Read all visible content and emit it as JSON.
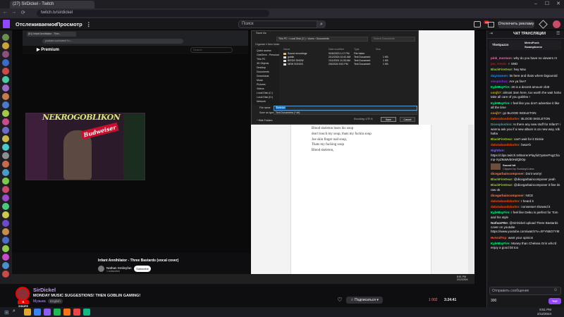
{
  "browser": {
    "tab_title": "(27) SirDickel - Twitch",
    "url": "twitch.tv/sirdickel",
    "window_controls": [
      "–",
      "☐",
      "✕"
    ],
    "nav_icons": [
      "←",
      "→",
      "⟳"
    ]
  },
  "twitch_nav": {
    "following": "Отслеживаемое",
    "browse": "Просмотр",
    "more": "⋮",
    "search_placeholder": "Поиск",
    "search_icon": "⌕",
    "notif_count": "42",
    "ads_button": "Отключить рекламу",
    "icons": [
      "crown-icon",
      "inbox-icon",
      "bits-icon"
    ]
  },
  "sidebar": {
    "avatar_colors": [
      "#6b8e4e",
      "#c9a23b",
      "#8a4f7d",
      "#3b6bc9",
      "#c94b4b",
      "#4bc9a2",
      "#9b6bc9",
      "#c97a4b",
      "#4b7ac9",
      "#a2c94b",
      "#c94b8e",
      "#6b6bc9",
      "#c9b84b",
      "#4bc9c9",
      "#8e8e8e",
      "#c96b4b",
      "#4b9bc9",
      "#7ac94b",
      "#c94b6b",
      "#9b4bc9",
      "#4bc97a",
      "#c9c94b",
      "#6b4bc9",
      "#c98e4b",
      "#4b6bc9",
      "#8ec94b",
      "#c94bc9",
      "#4b8ec9",
      "#c94b4b",
      "#7a7ac9"
    ]
  },
  "video": {
    "inner_tab": "(81) Infant Annihilator - Thre...",
    "inner_url": "youtube.com/watch?v=...",
    "yt_logo": "▶ Premium",
    "yt_search": "Search",
    "cam_logo": "NEKROGOBLIKON",
    "cam_brand": "Budweiser",
    "song_title": "Infant Annihilator - Three Bastards (vocal cover)",
    "channel_name": "Nathan Smileyfan",
    "channel_subs": "1 subscriber",
    "subscribe": "Subscribe"
  },
  "dialog": {
    "title": "Save As",
    "path": "This PC  ›  Local Disk (C:)  ›  Users  ›  Documents",
    "search": "Search Documents",
    "toolbar": "Organize ▾     New folder",
    "nav_items": [
      "Quick access",
      "OneDrive - Personal",
      "This PC",
      "3D Objects",
      "Desktop",
      "Documents",
      "Downloads",
      "Music",
      "Pictures",
      "Videos",
      "Local Disk (C:)",
      "Local Disk (D:)",
      "Network"
    ],
    "headers": [
      "Name",
      "Date modified",
      "Type",
      "Size"
    ],
    "files": [
      {
        "name": "Sound recordings",
        "date": "9/26/2023 1:17 PM",
        "type": "File folder",
        "size": ""
      },
      {
        "name": "goblin",
        "date": "2/12/2024 10:42 AM",
        "type": "Text Document",
        "size": "1 KB"
      },
      {
        "name": "BIRDS SHOW",
        "date": "1/11/2024 11:33 AM",
        "type": "Text Document",
        "size": "1 KB"
      },
      {
        "name": "NEW SONGS",
        "date": "2/6/2024 9:51 PM",
        "type": "Text Document",
        "size": "1 KB"
      }
    ],
    "file_name_label": "File name:",
    "file_name": "Skeleton",
    "save_type_label": "Save as type:",
    "save_type": "Text Documents (*.txt)",
    "hide_folders": "^  Hide Folders",
    "encoding": "Encoding:  UTF-8",
    "save": "Save",
    "cancel": "Cancel"
  },
  "notepad": {
    "lines": [
      "Blood skeleton loses his soup",
      "don't touch my soup, thats my fuckin soup",
      "Joe skin finger nail soup,",
      "Thats my fucking soup",
      "Blood skeleton,"
    ]
  },
  "player_bar": {
    "clock_time": "8:51 PM",
    "clock_date": "2/12/2024"
  },
  "stream": {
    "streamer": "SirDickel",
    "live": "В ЭФИРЕ",
    "title": "MONDAY MUSIC SUGGESTIONS! THEN GOBLIN GAMING!",
    "category": "Музыка",
    "tag": "English",
    "viewers": "1 002",
    "uptime": "3:24:41",
    "follow_icon": "♡",
    "subscribe": "☆ Подписаться ▾"
  },
  "chat": {
    "title": "ЧАТ ТРАНСЛЯЦИИ",
    "leaderboard": [
      {
        "name": "TheSpazzn",
        "value": "3 4"
      },
      {
        "name": "MetroPunk",
        "value": ""
      },
      {
        "name": "Swampborne",
        "value": "4"
      }
    ],
    "messages": [
      {
        "user": "pink_mormon",
        "color": "#ff69b4",
        "text": "why do you have no viewers rn"
      },
      {
        "user": "joo_Kevin",
        "color": "#b22222",
        "text": "♀ SND"
      },
      {
        "user": "BlackFireDear",
        "color": "#9acd32",
        "text": "hey Max"
      },
      {
        "user": "dayreamen",
        "color": "#1e90ff",
        "text": "Its here and thats where bigouroid"
      },
      {
        "user": "sleeptohuz",
        "color": "#8a2be2",
        "text": "Are ya fine?"
      },
      {
        "user": "KyleMayFire",
        "color": "#00ff7f",
        "text": "40 is a decent amount cb3t"
      },
      {
        "user": "coojh7",
        "color": "#daa520",
        "text": "almost 3am here, too worth the wait haha take all care of you goblins !"
      },
      {
        "user": "KyleMayFire",
        "color": "#00ff7f",
        "text": "I feel like you don't advertise it like all the time"
      },
      {
        "user": "coojh7",
        "color": "#daa520",
        "text": "go BLOOD SKELETON"
      },
      {
        "user": "dakotabandsbutter",
        "color": "#ff4500",
        "text": "BLOOD SKELETON"
      },
      {
        "user": "Dicexplostion",
        "color": "#5f9ea0",
        "text": "Is there any new stuff for Infant? i wanna ask you if a new album is on new way, Idk haha"
      },
      {
        "user": "BlackFireDear",
        "color": "#9acd32",
        "text": "can't wait for it Dickie"
      },
      {
        "user": "dakotabandsbutter",
        "color": "#ff4500",
        "text": "bwaAh"
      },
      {
        "user": "Nightbot",
        "color": "#7b68ee",
        "text": "https://clips.twitch.tv/BarrenPlayfulOysterPogChamp-XyZ9aMvb0HdQbOp"
      },
      {
        "user": "",
        "color": "",
        "text": "Sound bit"
      },
      {
        "user": "dicegarbaincomposer",
        "color": "#ff7f50",
        "text": "Dont worry!"
      },
      {
        "user": "BlackFireDear",
        "color": "#9acd32",
        "text": "@dicegarbaincomposer yeah"
      },
      {
        "user": "BlackFireDear",
        "color": "#9acd32",
        "text": "@dicegarbaincomposer it fine its raw ok"
      },
      {
        "user": "dicegarbaincomposer",
        "color": "#ff7f50",
        "text": "NICE"
      },
      {
        "user": "dakotabandsbutter",
        "color": "#ff4500",
        "text": "I heard it"
      },
      {
        "user": "dakotabandsbutter",
        "color": "#ff4500",
        "text": "nonsense! showed it"
      },
      {
        "user": "KyleMayFire",
        "color": "#00ff7f",
        "text": "I feel like Deiko is perfect for Tom and his style"
      },
      {
        "user": "NathanFBe",
        "color": "#e0e0e0",
        "text": "@SirDickel upload Three Bastards cover on youtube https://www.youtube.com/watch?v=XFY5BO7Y9t"
      },
      {
        "user": "HvAndToy",
        "color": "#ff6347",
        "text": "want your opinion"
      },
      {
        "user": "KyleMayFire",
        "color": "#00ff7f",
        "text": "Money than Chelsea Grin who'd enjoy a good bit too"
      }
    ],
    "clip_title": "Sound bit",
    "clip_by": "Clipped by SundayCobra",
    "input_placeholder": "Отправить сообщение",
    "emote_icon": "☺",
    "points": "300",
    "send_button": "Чат"
  },
  "taskbar": {
    "start": "⊞",
    "search": "⌕",
    "app_colors": [
      "#e0a82e",
      "#3b82f6",
      "#8b5cf6",
      "#1db954",
      "#f97316",
      "#ef4444",
      "#10b981"
    ],
    "clock_time": "8:51 PM",
    "clock_date": "2/12/2024"
  }
}
